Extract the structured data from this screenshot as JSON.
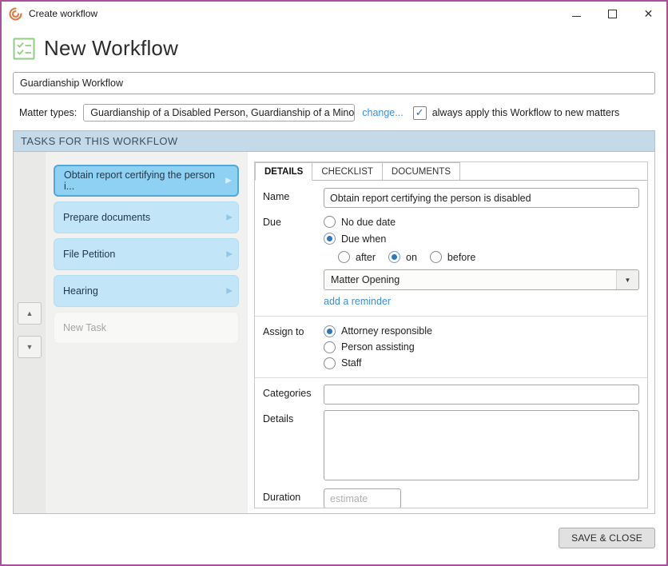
{
  "window": {
    "title": "Create workflow"
  },
  "header": {
    "title": "New Workflow"
  },
  "workflow_name": {
    "value": "Guardianship Workflow"
  },
  "matter_types": {
    "label": "Matter types:",
    "value": "Guardianship of a Disabled Person, Guardianship of a Minor",
    "change_link": "change...",
    "always_apply_label": "always apply this Workflow to new matters",
    "always_apply_checked": true
  },
  "tasks_section": {
    "header": "TASKS FOR THIS WORKFLOW",
    "tasks": [
      {
        "label": "Obtain report certifying the person i...",
        "selected": true
      },
      {
        "label": "Prepare documents",
        "selected": false
      },
      {
        "label": "File Petition",
        "selected": false
      },
      {
        "label": "Hearing",
        "selected": false
      }
    ],
    "new_task_label": "New Task"
  },
  "details_panel": {
    "tabs": [
      {
        "label": "DETAILS",
        "active": true
      },
      {
        "label": "CHECKLIST",
        "active": false
      },
      {
        "label": "DOCUMENTS",
        "active": false
      }
    ],
    "name": {
      "label": "Name",
      "value": "Obtain report certifying the person is disabled"
    },
    "due": {
      "label": "Due",
      "options": [
        "No due date",
        "Due when"
      ],
      "selected": "Due when",
      "when_options": [
        "after",
        "on",
        "before"
      ],
      "when_selected": "on",
      "anchor_value": "Matter Opening",
      "reminder_link": "add a reminder"
    },
    "assign_to": {
      "label": "Assign to",
      "options": [
        "Attorney responsible",
        "Person assisting",
        "Staff"
      ],
      "selected": "Attorney responsible"
    },
    "categories": {
      "label": "Categories",
      "value": ""
    },
    "details": {
      "label": "Details",
      "value": ""
    },
    "duration": {
      "label": "Duration",
      "value": "",
      "placeholder": "estimate"
    }
  },
  "footer": {
    "save_close_label": "SAVE & CLOSE"
  },
  "icons": {
    "check": "✓",
    "task_arrow": "▶",
    "up_arrow": "▲",
    "down_arrow": "▼",
    "dropdown_arrow": "▼",
    "close": "✕"
  },
  "colors": {
    "window_border": "#AC4F9E",
    "logo_orange": "#E2793F",
    "workflow_icon_green": "#93CD85",
    "link_blue": "#3D8ED8",
    "radio_blue": "#2E75BA",
    "tasks_header_bg": "#C5DAE9",
    "task_selected_bg": "#8ED1F2",
    "task_selected_border": "#52A7DC",
    "task_bg": "#C2E5F7"
  }
}
